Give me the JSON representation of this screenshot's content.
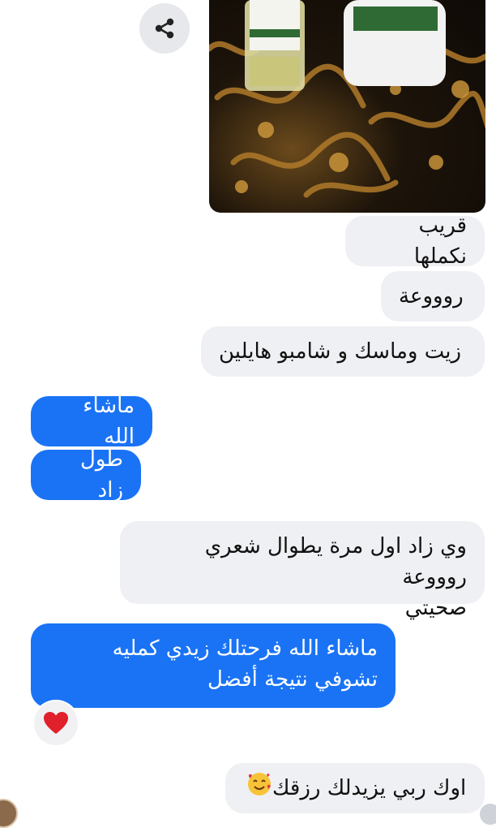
{
  "messages": [
    {
      "id": "m1",
      "dir": "in",
      "text": "قريب نكملها"
    },
    {
      "id": "m2",
      "dir": "in",
      "text": "روووعة"
    },
    {
      "id": "m3",
      "dir": "in",
      "text": "زيت وماسك و شامبو هايلين"
    },
    {
      "id": "m4",
      "dir": "out",
      "text": "ماشاء الله"
    },
    {
      "id": "m5",
      "dir": "out",
      "text": "طول زاد"
    },
    {
      "id": "m6",
      "dir": "in",
      "line1": "وي زاد اول مرة يطوال شعري روووعة",
      "line2": "صحيتي"
    },
    {
      "id": "m7",
      "dir": "out",
      "line1": "ماشاء  الله فرحتلك زيدي كمليه",
      "line2": "تشوفي نتيجة أفضل"
    },
    {
      "id": "m8",
      "dir": "in",
      "text": "اوك ربي يزيدلك رزقك",
      "emoji": "smiling-face-with-hearts-icon"
    }
  ],
  "reaction": {
    "icon": "heart-icon",
    "color": "#e0202a"
  },
  "colors": {
    "outgoing": "#1a73f5",
    "incoming": "#eff0f3"
  }
}
